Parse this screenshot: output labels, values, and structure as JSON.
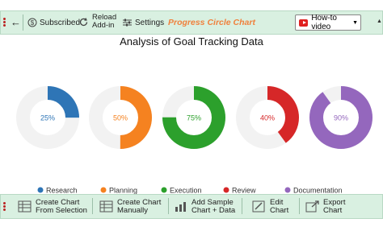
{
  "toolbar_top": {
    "back_label": "←",
    "subscribed_label": "Subscribed",
    "reload_label_line1": "Reload",
    "reload_label_line2": "Add-in",
    "settings_label": "Settings",
    "brand_label": "Progress Circle Chart",
    "howto_label": "How-to video"
  },
  "toolbar_bottom": {
    "create_from_selection_line1": "Create Chart",
    "create_from_selection_line2": "From Selection",
    "create_manually_line1": "Create Chart",
    "create_manually_line2": "Manually",
    "add_sample_line1": "Add Sample",
    "add_sample_line2": "Chart + Data",
    "edit_line1": "Edit",
    "edit_line2": "Chart",
    "export_line1": "Export",
    "export_line2": "Chart"
  },
  "chart_data": {
    "type": "progress-circle",
    "title": "Analysis of Goal Tracking Data",
    "categories": [
      "Research",
      "Planning",
      "Execution",
      "Review",
      "Documentation"
    ],
    "values": [
      25,
      50,
      75,
      40,
      90
    ],
    "value_labels": [
      "25%",
      "50%",
      "75%",
      "40%",
      "90%"
    ],
    "colors": [
      "#2e75b6",
      "#f58220",
      "#2ca02c",
      "#d62728",
      "#9467bd"
    ],
    "track_color": "#f2f2f2",
    "label_colors": [
      "#2e75b6",
      "#f58220",
      "#2ca02c",
      "#d62728",
      "#9467bd"
    ],
    "legend_position": "bottom"
  }
}
